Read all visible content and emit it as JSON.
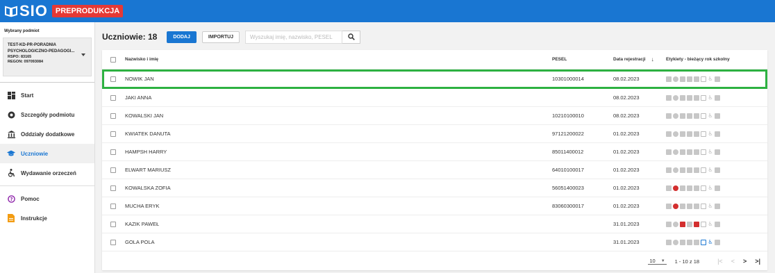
{
  "app": {
    "title": "SIO",
    "badge": "PREPRODUKCJA",
    "brand_color": "#1976d2",
    "badge_color": "#e53935"
  },
  "sidebar": {
    "section_label": "Wybrany podmiot",
    "subject": {
      "name": "TEST-KD-PR-PORADNIA PSYCHOLOGICZNO-PEDAGOGI...",
      "rspo": "RSPO: 83165",
      "regon": "REGON: 097093084"
    },
    "items": [
      {
        "label": "Start",
        "icon": "dashboard-icon"
      },
      {
        "label": "Szczegóły podmiotu",
        "icon": "info-circle-icon"
      },
      {
        "label": "Oddziały dodatkowe",
        "icon": "building-icon"
      },
      {
        "label": "Uczniowie",
        "icon": "graduation-cap-icon",
        "active": true
      },
      {
        "label": "Wydawanie orzeczeń",
        "icon": "accessibility-icon"
      }
    ],
    "help_items": [
      {
        "label": "Pomoc",
        "icon": "help-circle-icon"
      },
      {
        "label": "Instrukcje",
        "icon": "document-icon"
      }
    ]
  },
  "toolbar": {
    "title": "Uczniowie: 18",
    "add_label": "DODAJ",
    "import_label": "IMPORTUJ",
    "search_placeholder": "Wyszukaj imię, nazwisko, PESEL"
  },
  "table": {
    "headers": {
      "name": "Nazwisko i imię",
      "pesel": "PESEL",
      "date": "Data rejestracji",
      "tags": "Etykiety - bieżący rok szkolny"
    },
    "rows": [
      {
        "name": "NOWIK JAN",
        "pesel": "10301000014",
        "date": "08.02.2023",
        "selected": true
      },
      {
        "name": "JAKI ANNA",
        "pesel": "",
        "date": "08.02.2023"
      },
      {
        "name": "KOWALSKI JAN",
        "pesel": "10210100010",
        "date": "08.02.2023"
      },
      {
        "name": "KWIATEK DANUTA",
        "pesel": "97121200022",
        "date": "01.02.2023"
      },
      {
        "name": "HAMPSH HARRY",
        "pesel": "85011400012",
        "date": "01.02.2023"
      },
      {
        "name": "ELWART MARIUSZ",
        "pesel": "64010100017",
        "date": "01.02.2023"
      },
      {
        "name": "KOWALSKA ZOFIA",
        "pesel": "56051400023",
        "date": "01.02.2023",
        "tag_clock_red": true
      },
      {
        "name": "MUCHA ERYK",
        "pesel": "83060300017",
        "date": "01.02.2023",
        "tag_clock_red": true
      },
      {
        "name": "KAZIK PAWEŁ",
        "pesel": "",
        "date": "31.01.2023",
        "tag_multi_red": true
      },
      {
        "name": "GOLA POLA",
        "pesel": "",
        "date": "31.01.2023",
        "tag_blue": true
      }
    ]
  },
  "pagination": {
    "per_page": "10",
    "range": "1 - 10 z 18"
  },
  "highlight_color": "#2db141"
}
